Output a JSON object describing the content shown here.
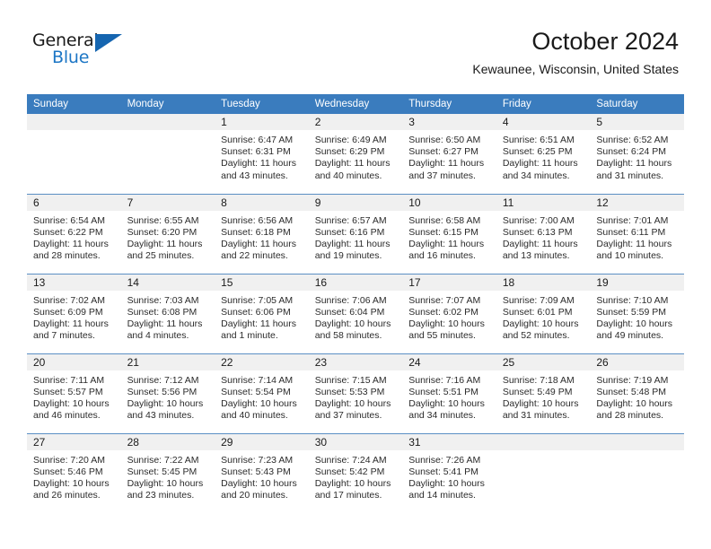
{
  "brand": {
    "word1": "General",
    "word2": "Blue",
    "logo_icon": "triangle-logo-icon",
    "accent_color": "#1565b0"
  },
  "header": {
    "title": "October 2024",
    "location": "Kewaunee, Wisconsin, United States"
  },
  "theme": {
    "header_row_bg": "#3a7cbe",
    "header_row_text": "#ffffff",
    "daynum_bg": "#f0f0f0",
    "week_divider": "#5b8fc4"
  },
  "weekday_headers": [
    "Sunday",
    "Monday",
    "Tuesday",
    "Wednesday",
    "Thursday",
    "Friday",
    "Saturday"
  ],
  "weeks": [
    [
      {
        "day": "",
        "sunrise": "",
        "sunset": "",
        "daylight_line1": "",
        "daylight_line2": "",
        "blank": true
      },
      {
        "day": "",
        "sunrise": "",
        "sunset": "",
        "daylight_line1": "",
        "daylight_line2": "",
        "blank": true
      },
      {
        "day": "1",
        "sunrise": "Sunrise: 6:47 AM",
        "sunset": "Sunset: 6:31 PM",
        "daylight_line1": "Daylight: 11 hours",
        "daylight_line2": "and 43 minutes."
      },
      {
        "day": "2",
        "sunrise": "Sunrise: 6:49 AM",
        "sunset": "Sunset: 6:29 PM",
        "daylight_line1": "Daylight: 11 hours",
        "daylight_line2": "and 40 minutes."
      },
      {
        "day": "3",
        "sunrise": "Sunrise: 6:50 AM",
        "sunset": "Sunset: 6:27 PM",
        "daylight_line1": "Daylight: 11 hours",
        "daylight_line2": "and 37 minutes."
      },
      {
        "day": "4",
        "sunrise": "Sunrise: 6:51 AM",
        "sunset": "Sunset: 6:25 PM",
        "daylight_line1": "Daylight: 11 hours",
        "daylight_line2": "and 34 minutes."
      },
      {
        "day": "5",
        "sunrise": "Sunrise: 6:52 AM",
        "sunset": "Sunset: 6:24 PM",
        "daylight_line1": "Daylight: 11 hours",
        "daylight_line2": "and 31 minutes."
      }
    ],
    [
      {
        "day": "6",
        "sunrise": "Sunrise: 6:54 AM",
        "sunset": "Sunset: 6:22 PM",
        "daylight_line1": "Daylight: 11 hours",
        "daylight_line2": "and 28 minutes."
      },
      {
        "day": "7",
        "sunrise": "Sunrise: 6:55 AM",
        "sunset": "Sunset: 6:20 PM",
        "daylight_line1": "Daylight: 11 hours",
        "daylight_line2": "and 25 minutes."
      },
      {
        "day": "8",
        "sunrise": "Sunrise: 6:56 AM",
        "sunset": "Sunset: 6:18 PM",
        "daylight_line1": "Daylight: 11 hours",
        "daylight_line2": "and 22 minutes."
      },
      {
        "day": "9",
        "sunrise": "Sunrise: 6:57 AM",
        "sunset": "Sunset: 6:16 PM",
        "daylight_line1": "Daylight: 11 hours",
        "daylight_line2": "and 19 minutes."
      },
      {
        "day": "10",
        "sunrise": "Sunrise: 6:58 AM",
        "sunset": "Sunset: 6:15 PM",
        "daylight_line1": "Daylight: 11 hours",
        "daylight_line2": "and 16 minutes."
      },
      {
        "day": "11",
        "sunrise": "Sunrise: 7:00 AM",
        "sunset": "Sunset: 6:13 PM",
        "daylight_line1": "Daylight: 11 hours",
        "daylight_line2": "and 13 minutes."
      },
      {
        "day": "12",
        "sunrise": "Sunrise: 7:01 AM",
        "sunset": "Sunset: 6:11 PM",
        "daylight_line1": "Daylight: 11 hours",
        "daylight_line2": "and 10 minutes."
      }
    ],
    [
      {
        "day": "13",
        "sunrise": "Sunrise: 7:02 AM",
        "sunset": "Sunset: 6:09 PM",
        "daylight_line1": "Daylight: 11 hours",
        "daylight_line2": "and 7 minutes."
      },
      {
        "day": "14",
        "sunrise": "Sunrise: 7:03 AM",
        "sunset": "Sunset: 6:08 PM",
        "daylight_line1": "Daylight: 11 hours",
        "daylight_line2": "and 4 minutes."
      },
      {
        "day": "15",
        "sunrise": "Sunrise: 7:05 AM",
        "sunset": "Sunset: 6:06 PM",
        "daylight_line1": "Daylight: 11 hours",
        "daylight_line2": "and 1 minute."
      },
      {
        "day": "16",
        "sunrise": "Sunrise: 7:06 AM",
        "sunset": "Sunset: 6:04 PM",
        "daylight_line1": "Daylight: 10 hours",
        "daylight_line2": "and 58 minutes."
      },
      {
        "day": "17",
        "sunrise": "Sunrise: 7:07 AM",
        "sunset": "Sunset: 6:02 PM",
        "daylight_line1": "Daylight: 10 hours",
        "daylight_line2": "and 55 minutes."
      },
      {
        "day": "18",
        "sunrise": "Sunrise: 7:09 AM",
        "sunset": "Sunset: 6:01 PM",
        "daylight_line1": "Daylight: 10 hours",
        "daylight_line2": "and 52 minutes."
      },
      {
        "day": "19",
        "sunrise": "Sunrise: 7:10 AM",
        "sunset": "Sunset: 5:59 PM",
        "daylight_line1": "Daylight: 10 hours",
        "daylight_line2": "and 49 minutes."
      }
    ],
    [
      {
        "day": "20",
        "sunrise": "Sunrise: 7:11 AM",
        "sunset": "Sunset: 5:57 PM",
        "daylight_line1": "Daylight: 10 hours",
        "daylight_line2": "and 46 minutes."
      },
      {
        "day": "21",
        "sunrise": "Sunrise: 7:12 AM",
        "sunset": "Sunset: 5:56 PM",
        "daylight_line1": "Daylight: 10 hours",
        "daylight_line2": "and 43 minutes."
      },
      {
        "day": "22",
        "sunrise": "Sunrise: 7:14 AM",
        "sunset": "Sunset: 5:54 PM",
        "daylight_line1": "Daylight: 10 hours",
        "daylight_line2": "and 40 minutes."
      },
      {
        "day": "23",
        "sunrise": "Sunrise: 7:15 AM",
        "sunset": "Sunset: 5:53 PM",
        "daylight_line1": "Daylight: 10 hours",
        "daylight_line2": "and 37 minutes."
      },
      {
        "day": "24",
        "sunrise": "Sunrise: 7:16 AM",
        "sunset": "Sunset: 5:51 PM",
        "daylight_line1": "Daylight: 10 hours",
        "daylight_line2": "and 34 minutes."
      },
      {
        "day": "25",
        "sunrise": "Sunrise: 7:18 AM",
        "sunset": "Sunset: 5:49 PM",
        "daylight_line1": "Daylight: 10 hours",
        "daylight_line2": "and 31 minutes."
      },
      {
        "day": "26",
        "sunrise": "Sunrise: 7:19 AM",
        "sunset": "Sunset: 5:48 PM",
        "daylight_line1": "Daylight: 10 hours",
        "daylight_line2": "and 28 minutes."
      }
    ],
    [
      {
        "day": "27",
        "sunrise": "Sunrise: 7:20 AM",
        "sunset": "Sunset: 5:46 PM",
        "daylight_line1": "Daylight: 10 hours",
        "daylight_line2": "and 26 minutes."
      },
      {
        "day": "28",
        "sunrise": "Sunrise: 7:22 AM",
        "sunset": "Sunset: 5:45 PM",
        "daylight_line1": "Daylight: 10 hours",
        "daylight_line2": "and 23 minutes."
      },
      {
        "day": "29",
        "sunrise": "Sunrise: 7:23 AM",
        "sunset": "Sunset: 5:43 PM",
        "daylight_line1": "Daylight: 10 hours",
        "daylight_line2": "and 20 minutes."
      },
      {
        "day": "30",
        "sunrise": "Sunrise: 7:24 AM",
        "sunset": "Sunset: 5:42 PM",
        "daylight_line1": "Daylight: 10 hours",
        "daylight_line2": "and 17 minutes."
      },
      {
        "day": "31",
        "sunrise": "Sunrise: 7:26 AM",
        "sunset": "Sunset: 5:41 PM",
        "daylight_line1": "Daylight: 10 hours",
        "daylight_line2": "and 14 minutes."
      },
      {
        "day": "",
        "sunrise": "",
        "sunset": "",
        "daylight_line1": "",
        "daylight_line2": "",
        "blank": true
      },
      {
        "day": "",
        "sunrise": "",
        "sunset": "",
        "daylight_line1": "",
        "daylight_line2": "",
        "blank": true
      }
    ]
  ]
}
